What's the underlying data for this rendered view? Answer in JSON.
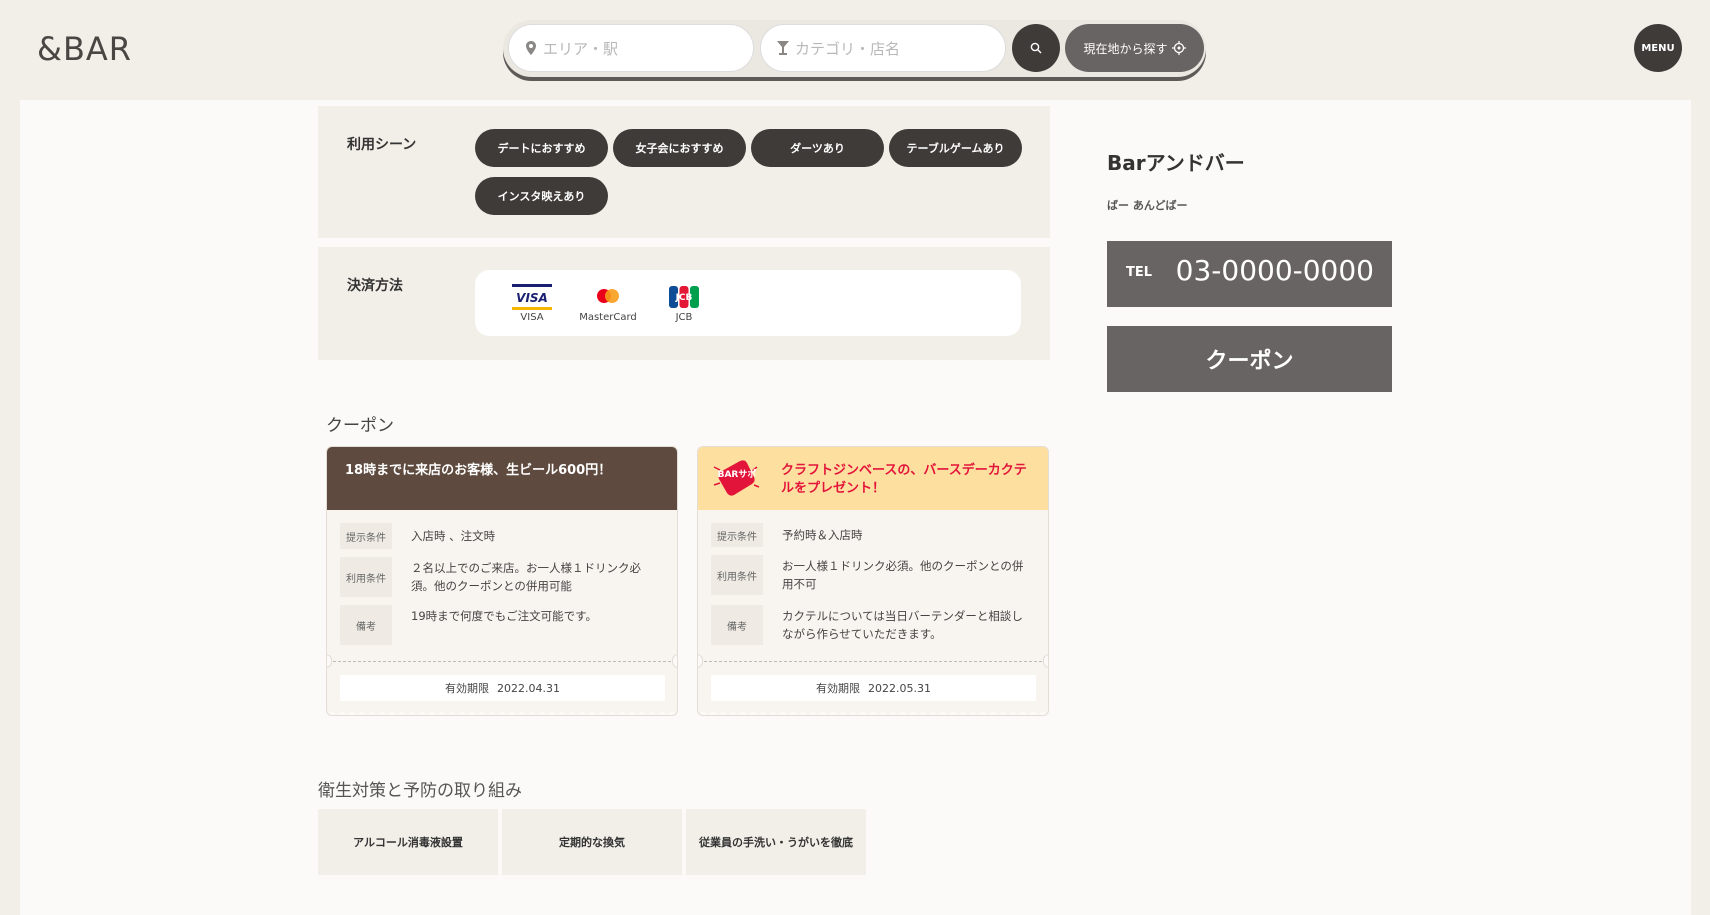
{
  "header": {
    "logo": "&BAR",
    "search_area_placeholder": "エリア・駅",
    "search_category_placeholder": "カテゴリ・店名",
    "location_button": "現在地から探す",
    "menu_button": "MENU"
  },
  "scene": {
    "label": "利用シーン",
    "tags": [
      "デートにおすすめ",
      "女子会におすすめ",
      "ダーツあり",
      "テーブルゲームあり",
      "インスタ映えあり"
    ]
  },
  "payment": {
    "label": "決済方法",
    "cards": [
      "VISA",
      "MasterCard",
      "JCB"
    ]
  },
  "coupons": {
    "title": "クーポン",
    "items": [
      {
        "title": "18時までに来店のお客様、生ビール600円！",
        "rows": [
          {
            "key": "提示条件",
            "value": "入店時 、注文時"
          },
          {
            "key": "利用条件",
            "value": "２名以上でのご来店。お一人様１ドリンク必須。他のクーポンとの併用可能"
          },
          {
            "key": "備考",
            "value": "19時まで何度でもご注文可能です。"
          }
        ],
        "expiry_label": "有効期限",
        "expiry_date": "2022.04.31"
      },
      {
        "badge": "BARサポ",
        "title": "クラフトジンベースの、バースデーカクテルをプレゼント！",
        "rows": [
          {
            "key": "提示条件",
            "value": "予約時＆入店時"
          },
          {
            "key": "利用条件",
            "value": "お一人様１ドリンク必須。他のクーポンとの併用不可"
          },
          {
            "key": "備考",
            "value": "カクテルについては当日バーテンダーと相談しながら作らせていただきます。"
          }
        ],
        "expiry_label": "有効期限",
        "expiry_date": "2022.05.31"
      }
    ]
  },
  "hygiene": {
    "title": "衛生対策と予防の取り組み",
    "items": [
      "アルコール消毒液設置",
      "定期的な換気",
      "従業員の手洗い・うがいを徹底"
    ]
  },
  "shop": {
    "name": "Barアンドバー",
    "kana": "ばー あんどばー",
    "tel_label": "TEL",
    "tel": "03-0000-0000",
    "coupon_button": "クーポン"
  },
  "colors": {
    "background": "#f2efe9",
    "dark": "#3f3b39",
    "gray_button": "#686463",
    "coupon1_header": "#5e4a3e",
    "coupon2_header": "#fddfa0",
    "coupon2_text": "#e3143a"
  }
}
